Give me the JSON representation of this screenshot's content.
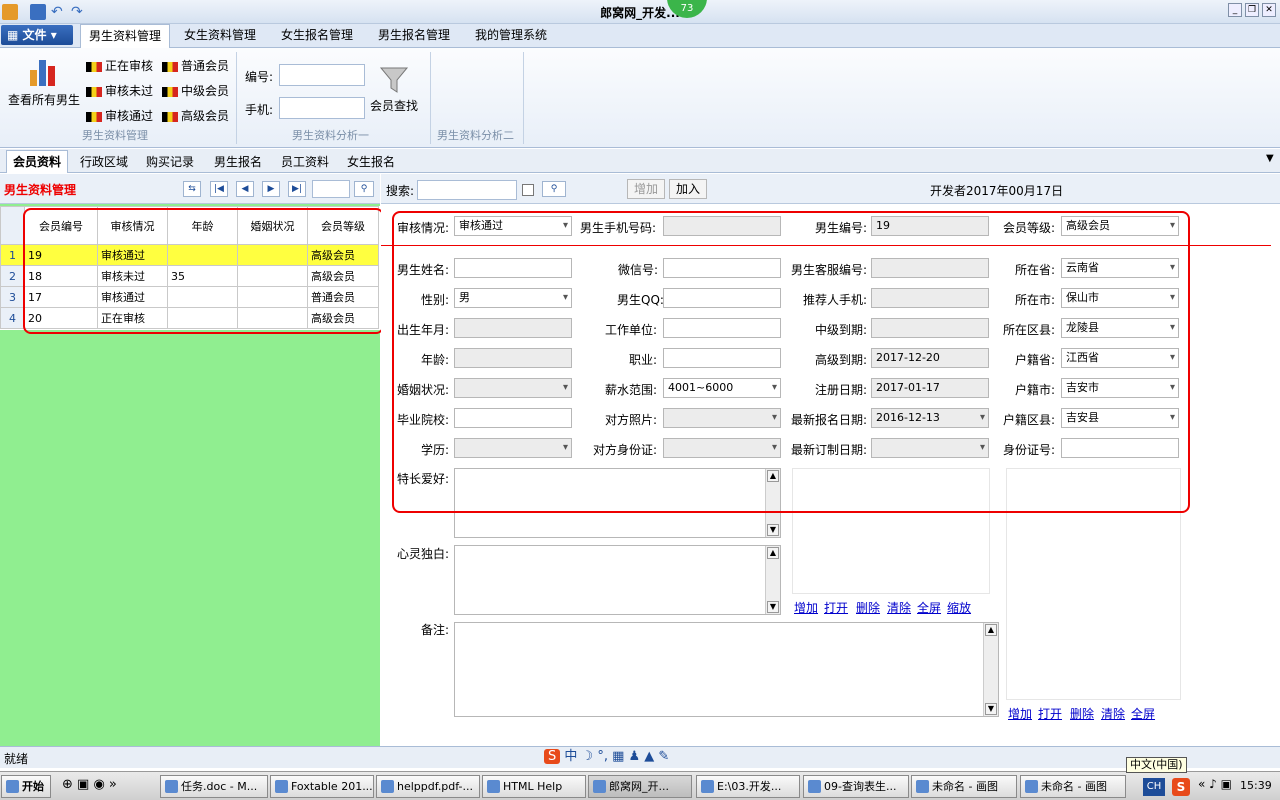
{
  "title": "郎窝网_开发...",
  "title_badge": "73",
  "menubar": {
    "file_label": "文件",
    "tabs": [
      "男生资料管理",
      "女生资料管理",
      "女生报名管理",
      "男生报名管理",
      "我的管理系统"
    ]
  },
  "ribbon": {
    "view_all": "查看所有男生",
    "status_items": [
      "正在审核",
      "审核未过",
      "审核通过"
    ],
    "level_items": [
      "普通会员",
      "中级会员",
      "高级会员"
    ],
    "group1_title": "男生资料管理",
    "number_label": "编号:",
    "phone_label": "手机:",
    "member_search": "会员查找",
    "group2_title": "男生资料分析一",
    "group3_title": "男生资料分析二"
  },
  "subtabs": [
    "会员资料",
    "行政区域",
    "购买记录",
    "男生报名",
    "员工资料",
    "女生报名"
  ],
  "left": {
    "title": "男生资料管理",
    "columns": [
      "会员编号",
      "审核情况",
      "年龄",
      "婚姻状况",
      "会员等级"
    ],
    "rows": [
      {
        "n": "1",
        "cells": [
          "19",
          "审核通过",
          "",
          "",
          "高级会员"
        ]
      },
      {
        "n": "2",
        "cells": [
          "18",
          "审核未过",
          "35",
          "",
          "高级会员"
        ]
      },
      {
        "n": "3",
        "cells": [
          "17",
          "审核通过",
          "",
          "",
          "普通会员"
        ]
      },
      {
        "n": "4",
        "cells": [
          "20",
          "正在审核",
          "",
          "",
          "高级会员"
        ]
      }
    ]
  },
  "right_header": {
    "search_label": "搜索:",
    "add_label": "增加",
    "join_label": "加入",
    "developer": "开发者2017年00月17日"
  },
  "form": {
    "review_label": "审核情况:",
    "review_value": "审核通过",
    "phone_label": "男生手机号码:",
    "male_no_label": "男生编号:",
    "male_no_value": "19",
    "level_label": "会员等级:",
    "level_value": "高级会员",
    "name_label": "男生姓名:",
    "wechat_label": "微信号:",
    "service_no_label": "男生客服编号:",
    "province_label": "所在省:",
    "province_value": "云南省",
    "gender_label": "性别:",
    "gender_value": "男",
    "qq_label": "男生QQ:",
    "referrer_label": "推荐人手机:",
    "city_label": "所在市:",
    "city_value": "保山市",
    "birth_label": "出生年月:",
    "work_label": "工作单位:",
    "mid_expire_label": "中级到期:",
    "county_label": "所在区县:",
    "county_value": "龙陵县",
    "age_label": "年龄:",
    "job_label": "职业:",
    "high_expire_label": "高级到期:",
    "high_expire_value": "2017-12-20",
    "hprov_label": "户籍省:",
    "hprov_value": "江西省",
    "marital_label": "婚姻状况:",
    "salary_label": "薪水范围:",
    "salary_value": "4001~6000",
    "reg_label": "注册日期:",
    "reg_value": "2017-01-17",
    "hcity_label": "户籍市:",
    "hcity_value": "吉安市",
    "school_label": "毕业院校:",
    "photo_label": "对方照片:",
    "latest_signup_label": "最新报名日期:",
    "latest_signup_value": "2016-12-13",
    "hcounty_label": "户籍区县:",
    "hcounty_value": "吉安县",
    "edu_label": "学历:",
    "id_card_label": "对方身份证:",
    "latest_order_label": "最新订制日期:",
    "id_no_label": "身份证号:",
    "hobby_label": "特长爱好:",
    "monologue_label": "心灵独白:",
    "note_label": "备注:"
  },
  "links1": [
    "增加",
    "打开",
    "删除",
    "清除",
    "全屏",
    "缩放"
  ],
  "links2": [
    "增加",
    "打开",
    "删除",
    "清除",
    "全屏"
  ],
  "statusbar": {
    "text": "就绪"
  },
  "taskbar": {
    "start": "开始",
    "items": [
      "任务.doc - M...",
      "Foxtable 201...",
      "helppdf.pdf-...",
      "HTML Help",
      "郎窝网_开...",
      "E:\\03.开发...",
      "09-查询表生...",
      "未命名 - 画图",
      "未命名 - 画图"
    ],
    "lang_tooltip": "中文(中国)",
    "lang": "CH",
    "clock": "15:39"
  }
}
